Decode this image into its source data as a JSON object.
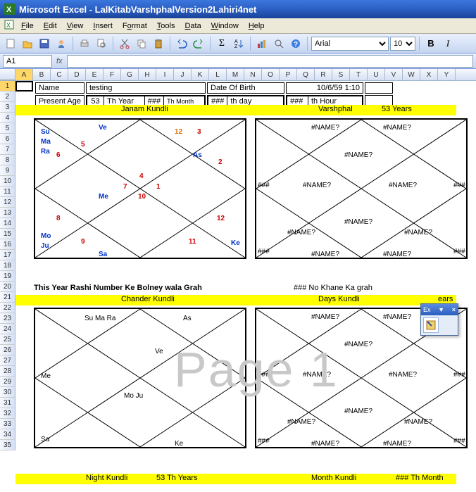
{
  "window": {
    "title": "Microsoft Excel - LalKitabVarshphalVersion2Lahiri4net"
  },
  "menu": {
    "file": "File",
    "edit": "Edit",
    "view": "View",
    "insert": "Insert",
    "format": "Format",
    "tools": "Tools",
    "data": "Data",
    "window": "Window",
    "help": "Help"
  },
  "toolbar": {
    "font": "Arial",
    "size": "10"
  },
  "namebox": {
    "ref": "A1"
  },
  "cols": [
    "A",
    "B",
    "C",
    "D",
    "E",
    "F",
    "G",
    "H",
    "I",
    "J",
    "K",
    "L",
    "M",
    "N",
    "O",
    "P",
    "Q",
    "R",
    "S",
    "T",
    "U",
    "V",
    "W",
    "X",
    "Y"
  ],
  "rows": [
    "1",
    "2",
    "3",
    "4",
    "5",
    "6",
    "7",
    "8",
    "9",
    "10",
    "11",
    "12",
    "13",
    "14",
    "15",
    "16",
    "17",
    "18",
    "19",
    "20",
    "21",
    "22",
    "23",
    "24",
    "25",
    "26",
    "27",
    "28",
    "29",
    "30",
    "31",
    "32",
    "33",
    "34",
    "35"
  ],
  "info": {
    "name_lbl": "Name",
    "name_val": "testing",
    "dob_lbl": "Date Of Birth",
    "dob_val": "10/6/59 1:10",
    "age_lbl": "Present Age",
    "age_val": "53",
    "thyear_lbl": "Th Year",
    "thyear_val": "###",
    "thmonth_lbl": "Th Month",
    "thmonth_val": "###",
    "thday_lbl": "th day",
    "thday_val": "###",
    "thhour_lbl": "th Hour"
  },
  "bars": {
    "b1_l": "Janam Kundli",
    "b1_r": "Varshphal",
    "b1_r2": "53 Years",
    "b2_l": "Chander Kundli",
    "b2_r": "Days Kundli",
    "b2_r2": "ears",
    "b3_l": "Night Kundli",
    "b3_l2": "53 Th Years",
    "b3_r": "Month Kundli",
    "b3_r2": "### Th Month"
  },
  "note": {
    "l": "This Year Rashi Number Ke Bolney wala Grah",
    "r": "### No Khane Ka grah"
  },
  "k1": {
    "Su": "Su",
    "Ma": "Ma",
    "Ra": "Ra",
    "Ve": "Ve",
    "Me": "Me",
    "Mo": "Mo",
    "Ju": "Ju",
    "Sa": "Sa",
    "As": "As",
    "Ke": "Ke",
    "n1": "1",
    "n2": "2",
    "n3": "3",
    "n4": "4",
    "n5": "5",
    "n6": "6",
    "n7": "7",
    "n8": "8",
    "n9": "9",
    "n10": "10",
    "n11": "11",
    "n12": "12"
  },
  "k2": {
    "nm": "#NAME?",
    "hsh": "###"
  },
  "k3": {
    "SuMaRa": "Su Ma Ra",
    "As": "As",
    "Ve": "Ve",
    "Me": "Me",
    "MoJu": "Mo Ju",
    "Sa": "Sa",
    "Ke": "Ke"
  },
  "float": {
    "title": "Ex"
  },
  "watermark": "Page 1"
}
